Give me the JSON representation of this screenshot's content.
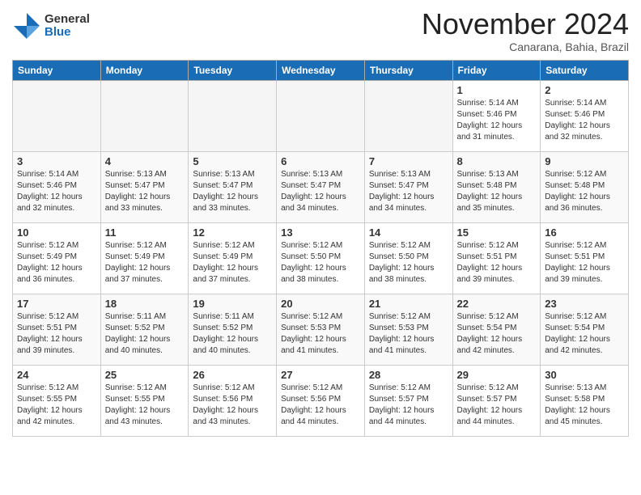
{
  "header": {
    "logo_general": "General",
    "logo_blue": "Blue",
    "month_title": "November 2024",
    "location": "Canarana, Bahia, Brazil"
  },
  "weekdays": [
    "Sunday",
    "Monday",
    "Tuesday",
    "Wednesday",
    "Thursday",
    "Friday",
    "Saturday"
  ],
  "weeks": [
    [
      {
        "day": "",
        "info": ""
      },
      {
        "day": "",
        "info": ""
      },
      {
        "day": "",
        "info": ""
      },
      {
        "day": "",
        "info": ""
      },
      {
        "day": "",
        "info": ""
      },
      {
        "day": "1",
        "info": "Sunrise: 5:14 AM\nSunset: 5:46 PM\nDaylight: 12 hours\nand 31 minutes."
      },
      {
        "day": "2",
        "info": "Sunrise: 5:14 AM\nSunset: 5:46 PM\nDaylight: 12 hours\nand 32 minutes."
      }
    ],
    [
      {
        "day": "3",
        "info": "Sunrise: 5:14 AM\nSunset: 5:46 PM\nDaylight: 12 hours\nand 32 minutes."
      },
      {
        "day": "4",
        "info": "Sunrise: 5:13 AM\nSunset: 5:47 PM\nDaylight: 12 hours\nand 33 minutes."
      },
      {
        "day": "5",
        "info": "Sunrise: 5:13 AM\nSunset: 5:47 PM\nDaylight: 12 hours\nand 33 minutes."
      },
      {
        "day": "6",
        "info": "Sunrise: 5:13 AM\nSunset: 5:47 PM\nDaylight: 12 hours\nand 34 minutes."
      },
      {
        "day": "7",
        "info": "Sunrise: 5:13 AM\nSunset: 5:47 PM\nDaylight: 12 hours\nand 34 minutes."
      },
      {
        "day": "8",
        "info": "Sunrise: 5:13 AM\nSunset: 5:48 PM\nDaylight: 12 hours\nand 35 minutes."
      },
      {
        "day": "9",
        "info": "Sunrise: 5:12 AM\nSunset: 5:48 PM\nDaylight: 12 hours\nand 36 minutes."
      }
    ],
    [
      {
        "day": "10",
        "info": "Sunrise: 5:12 AM\nSunset: 5:49 PM\nDaylight: 12 hours\nand 36 minutes."
      },
      {
        "day": "11",
        "info": "Sunrise: 5:12 AM\nSunset: 5:49 PM\nDaylight: 12 hours\nand 37 minutes."
      },
      {
        "day": "12",
        "info": "Sunrise: 5:12 AM\nSunset: 5:49 PM\nDaylight: 12 hours\nand 37 minutes."
      },
      {
        "day": "13",
        "info": "Sunrise: 5:12 AM\nSunset: 5:50 PM\nDaylight: 12 hours\nand 38 minutes."
      },
      {
        "day": "14",
        "info": "Sunrise: 5:12 AM\nSunset: 5:50 PM\nDaylight: 12 hours\nand 38 minutes."
      },
      {
        "day": "15",
        "info": "Sunrise: 5:12 AM\nSunset: 5:51 PM\nDaylight: 12 hours\nand 39 minutes."
      },
      {
        "day": "16",
        "info": "Sunrise: 5:12 AM\nSunset: 5:51 PM\nDaylight: 12 hours\nand 39 minutes."
      }
    ],
    [
      {
        "day": "17",
        "info": "Sunrise: 5:12 AM\nSunset: 5:51 PM\nDaylight: 12 hours\nand 39 minutes."
      },
      {
        "day": "18",
        "info": "Sunrise: 5:11 AM\nSunset: 5:52 PM\nDaylight: 12 hours\nand 40 minutes."
      },
      {
        "day": "19",
        "info": "Sunrise: 5:11 AM\nSunset: 5:52 PM\nDaylight: 12 hours\nand 40 minutes."
      },
      {
        "day": "20",
        "info": "Sunrise: 5:12 AM\nSunset: 5:53 PM\nDaylight: 12 hours\nand 41 minutes."
      },
      {
        "day": "21",
        "info": "Sunrise: 5:12 AM\nSunset: 5:53 PM\nDaylight: 12 hours\nand 41 minutes."
      },
      {
        "day": "22",
        "info": "Sunrise: 5:12 AM\nSunset: 5:54 PM\nDaylight: 12 hours\nand 42 minutes."
      },
      {
        "day": "23",
        "info": "Sunrise: 5:12 AM\nSunset: 5:54 PM\nDaylight: 12 hours\nand 42 minutes."
      }
    ],
    [
      {
        "day": "24",
        "info": "Sunrise: 5:12 AM\nSunset: 5:55 PM\nDaylight: 12 hours\nand 42 minutes."
      },
      {
        "day": "25",
        "info": "Sunrise: 5:12 AM\nSunset: 5:55 PM\nDaylight: 12 hours\nand 43 minutes."
      },
      {
        "day": "26",
        "info": "Sunrise: 5:12 AM\nSunset: 5:56 PM\nDaylight: 12 hours\nand 43 minutes."
      },
      {
        "day": "27",
        "info": "Sunrise: 5:12 AM\nSunset: 5:56 PM\nDaylight: 12 hours\nand 44 minutes."
      },
      {
        "day": "28",
        "info": "Sunrise: 5:12 AM\nSunset: 5:57 PM\nDaylight: 12 hours\nand 44 minutes."
      },
      {
        "day": "29",
        "info": "Sunrise: 5:12 AM\nSunset: 5:57 PM\nDaylight: 12 hours\nand 44 minutes."
      },
      {
        "day": "30",
        "info": "Sunrise: 5:13 AM\nSunset: 5:58 PM\nDaylight: 12 hours\nand 45 minutes."
      }
    ]
  ]
}
